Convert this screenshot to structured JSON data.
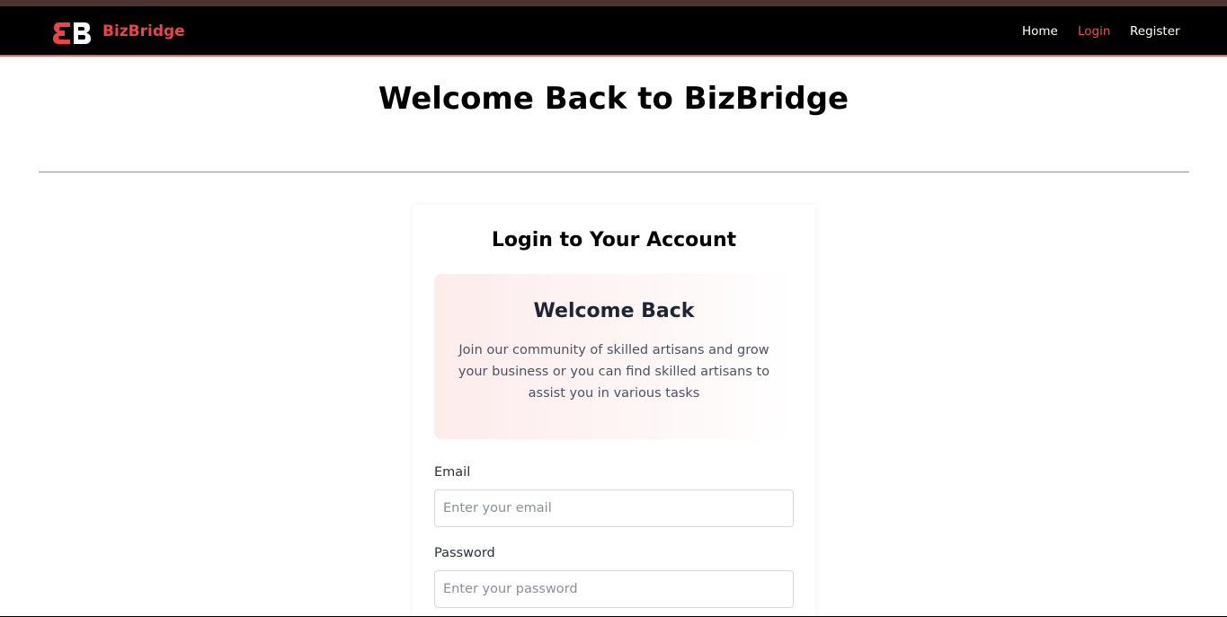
{
  "navbar": {
    "brand": "BizBridge",
    "logo_letters": "BB",
    "links": [
      {
        "label": "Home",
        "active": false
      },
      {
        "label": "Login",
        "active": true
      },
      {
        "label": "Register",
        "active": false
      }
    ]
  },
  "page": {
    "title": "Welcome Back to BizBridge"
  },
  "login_card": {
    "title": "Login to Your Account",
    "welcome_heading": "Welcome Back",
    "welcome_text": "Join our community of skilled artisans and grow your business or you can find skilled artisans to assist you in various tasks",
    "email_label": "Email",
    "email_value": "",
    "email_placeholder": "Enter your email",
    "password_label": "Password",
    "password_value": "",
    "password_placeholder": "Enter your password"
  },
  "colors": {
    "navbar_bg": "#000000",
    "brand_red": "#e8464a",
    "active_link": "#ef4f57",
    "divider": "#d97a4a"
  }
}
